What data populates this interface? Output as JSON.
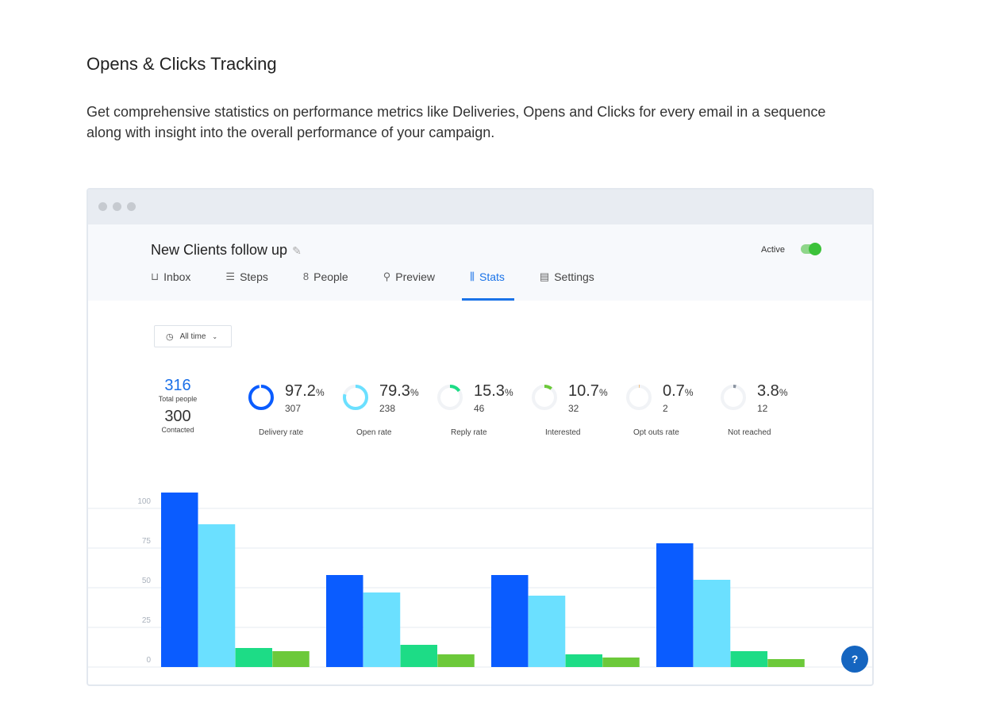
{
  "page": {
    "title": "Opens & Clicks Tracking",
    "description": "Get comprehensive statistics on performance metrics like Deliveries, Opens and Clicks for every email in a sequence along with insight into the overall performance of your campaign."
  },
  "app": {
    "campaign_title": "New Clients follow up",
    "status_label": "Active",
    "status_on": true,
    "tabs": [
      {
        "label": "Inbox",
        "icon": "inbox-icon"
      },
      {
        "label": "Steps",
        "icon": "list-icon"
      },
      {
        "label": "People",
        "icon": "people-icon"
      },
      {
        "label": "Preview",
        "icon": "search-icon"
      },
      {
        "label": "Stats",
        "icon": "chart-icon",
        "active": true
      },
      {
        "label": "Settings",
        "icon": "settings-icon"
      }
    ],
    "filter": "All time",
    "totals": {
      "total": "316",
      "total_label": "Total people",
      "contacted": "300",
      "contacted_label": "Contacted"
    },
    "metrics": [
      {
        "pct": "97.2",
        "count": "307",
        "label": "Delivery rate",
        "color": "#0a5cff"
      },
      {
        "pct": "79.3",
        "count": "238",
        "label": "Open rate",
        "color": "#6be0ff"
      },
      {
        "pct": "15.3",
        "count": "46",
        "label": "Reply rate",
        "color": "#1ddc86"
      },
      {
        "pct": "10.7",
        "count": "32",
        "label": "Interested",
        "color": "#6cc93a"
      },
      {
        "pct": "0.7",
        "count": "2",
        "label": "Opt outs rate",
        "color": "#f0c080"
      },
      {
        "pct": "3.8",
        "count": "12",
        "label": "Not reached",
        "color": "#8a93a0"
      }
    ],
    "pct_sign": "%"
  },
  "chart_data": {
    "type": "bar",
    "yticks": [
      0,
      25,
      50,
      75,
      100
    ],
    "ylim": [
      0,
      110
    ],
    "grid": true,
    "colors": [
      "#0a5cff",
      "#6be0ff",
      "#1ddc86",
      "#6cc93a"
    ],
    "groups": [
      [
        110,
        90,
        12,
        10
      ],
      [
        58,
        47,
        14,
        8
      ],
      [
        58,
        45,
        8,
        6
      ],
      [
        78,
        55,
        10,
        5
      ]
    ]
  }
}
